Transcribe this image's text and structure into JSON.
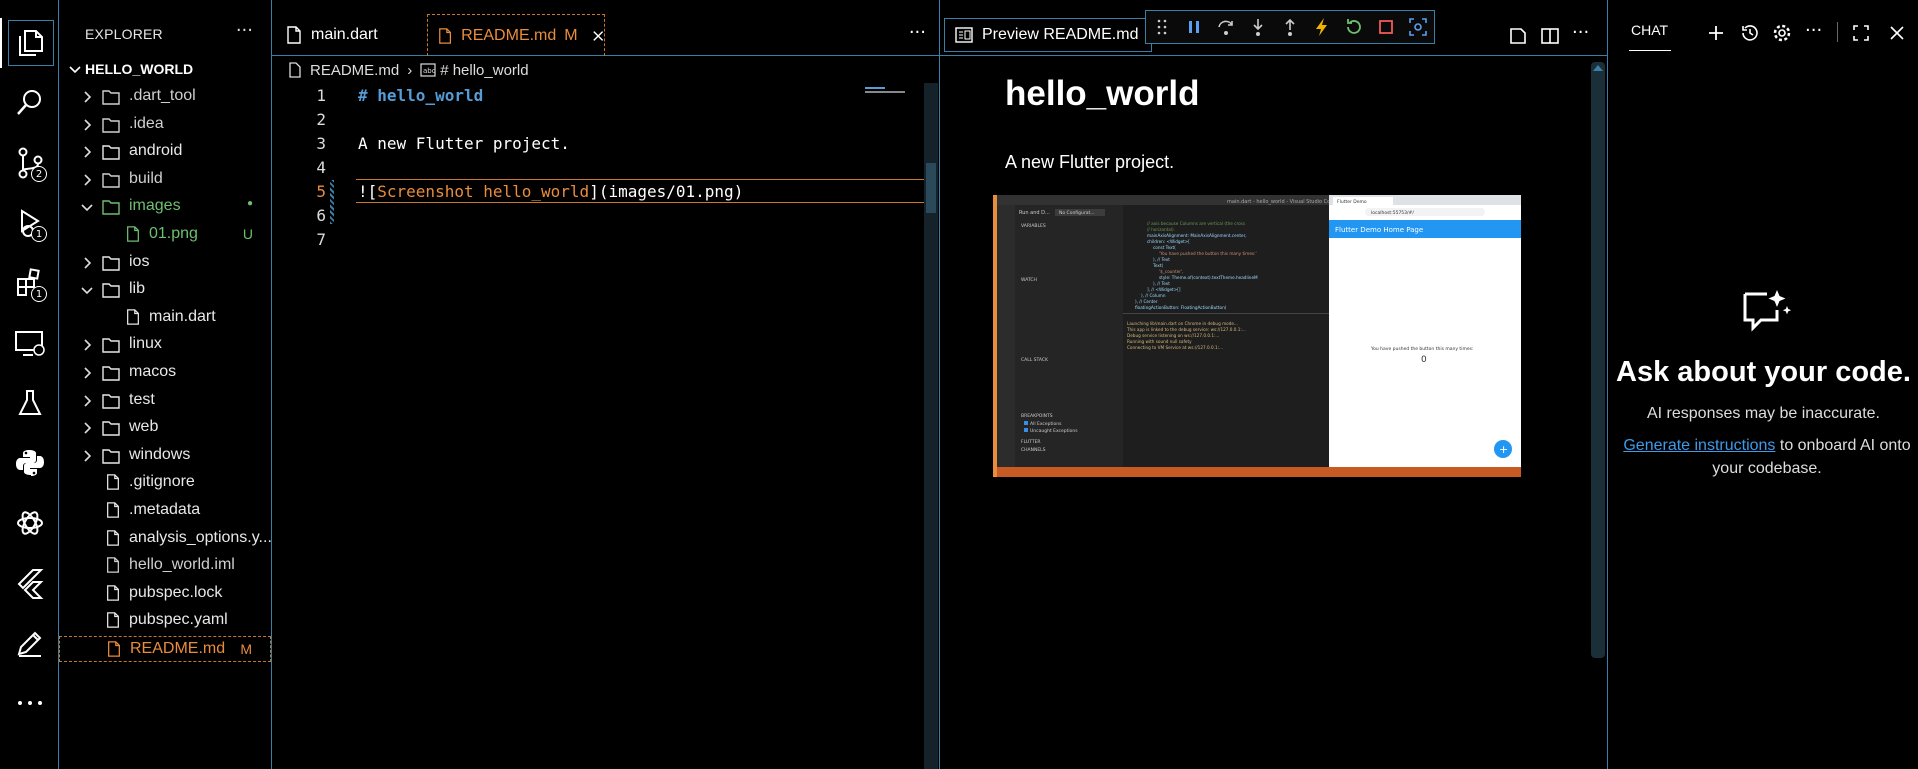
{
  "explorer": {
    "title": "EXPLORER",
    "root": "HELLO_WORLD",
    "items": [
      {
        "label": ".dart_tool",
        "type": "folder",
        "open": false,
        "depth": 1,
        "color": "#cfcfcf",
        "decoration": ""
      },
      {
        "label": ".idea",
        "type": "folder",
        "open": false,
        "depth": 1,
        "color": "#cfcfcf",
        "decoration": ""
      },
      {
        "label": "android",
        "type": "folder",
        "open": false,
        "depth": 1,
        "color": "#e8e8e8",
        "decoration": ""
      },
      {
        "label": "build",
        "type": "folder",
        "open": false,
        "depth": 1,
        "color": "#cfcfcf",
        "decoration": ""
      },
      {
        "label": "images",
        "type": "folder",
        "open": true,
        "depth": 1,
        "color": "#6cc070",
        "decoration": "●"
      },
      {
        "label": "01.png",
        "type": "file",
        "open": false,
        "depth": 2,
        "color": "#6cc070",
        "decoration": "U"
      },
      {
        "label": "ios",
        "type": "folder",
        "open": false,
        "depth": 1,
        "color": "#e8e8e8",
        "decoration": ""
      },
      {
        "label": "lib",
        "type": "folder",
        "open": true,
        "depth": 1,
        "color": "#e8e8e8",
        "decoration": ""
      },
      {
        "label": "main.dart",
        "type": "file",
        "open": false,
        "depth": 2,
        "color": "#e8e8e8",
        "decoration": ""
      },
      {
        "label": "linux",
        "type": "folder",
        "open": false,
        "depth": 1,
        "color": "#e8e8e8",
        "decoration": ""
      },
      {
        "label": "macos",
        "type": "folder",
        "open": false,
        "depth": 1,
        "color": "#e8e8e8",
        "decoration": ""
      },
      {
        "label": "test",
        "type": "folder",
        "open": false,
        "depth": 1,
        "color": "#e8e8e8",
        "decoration": ""
      },
      {
        "label": "web",
        "type": "folder",
        "open": false,
        "depth": 1,
        "color": "#e8e8e8",
        "decoration": ""
      },
      {
        "label": "windows",
        "type": "folder",
        "open": false,
        "depth": 1,
        "color": "#e8e8e8",
        "decoration": ""
      },
      {
        "label": ".gitignore",
        "type": "file",
        "open": false,
        "depth": 1,
        "color": "#e8e8e8",
        "decoration": ""
      },
      {
        "label": ".metadata",
        "type": "file",
        "open": false,
        "depth": 1,
        "color": "#e8e8e8",
        "decoration": ""
      },
      {
        "label": "analysis_options.y...",
        "type": "file",
        "open": false,
        "depth": 1,
        "color": "#e8e8e8",
        "decoration": ""
      },
      {
        "label": "hello_world.iml",
        "type": "file",
        "open": false,
        "depth": 1,
        "color": "#cfcfcf",
        "decoration": ""
      },
      {
        "label": "pubspec.lock",
        "type": "file",
        "open": false,
        "depth": 1,
        "color": "#e8e8e8",
        "decoration": ""
      },
      {
        "label": "pubspec.yaml",
        "type": "file",
        "open": false,
        "depth": 1,
        "color": "#e8e8e8",
        "decoration": ""
      },
      {
        "label": "README.md",
        "type": "file",
        "open": false,
        "depth": 1,
        "color": "#e98c3c",
        "decoration": "M",
        "selected": true
      }
    ]
  },
  "activity_badges": {
    "scm": "2",
    "debug": "1",
    "extensions": "1"
  },
  "editor": {
    "tabs": [
      {
        "label": "main.dart",
        "modified": ""
      },
      {
        "label": "README.md",
        "modified": "M"
      }
    ],
    "breadcrumb_file": "README.md",
    "breadcrumb_symbol": "# hello_world",
    "lines": [
      {
        "n": "1",
        "text": "# hello_world"
      },
      {
        "n": "2",
        "text": ""
      },
      {
        "n": "3",
        "text": "A new Flutter project."
      },
      {
        "n": "4",
        "text": ""
      },
      {
        "n": "5",
        "alt": "Screenshot hello_world",
        "path": "(images/01.png)"
      },
      {
        "n": "6",
        "text": ""
      },
      {
        "n": "7",
        "text": ""
      }
    ]
  },
  "preview": {
    "tab_label": "Preview README.md",
    "heading": "hello_world",
    "paragraph": "A new Flutter project.",
    "image": {
      "window_title": "main.dart - hello_world - Visual Studio Code",
      "run_label": "Run and D...",
      "config": "No Configurat...",
      "sections": [
        "VARIABLES",
        "WATCH",
        "CALL STACK",
        "BREAKPOINTS",
        "FLUTTER",
        "CHANNELS"
      ],
      "breakpoints": [
        "All Exceptions",
        "Uncaught Exceptions"
      ],
      "browser_tab": "Flutter Demo",
      "browser_url": "localhost:55753/#/",
      "app_title": "Flutter Demo Home Page",
      "counter_text": "You have pushed the button this many times:",
      "counter_value": "0",
      "fab_label": "+"
    }
  },
  "chat": {
    "tab": "CHAT",
    "title": "Ask about your code.",
    "subtitle": "AI responses may be inaccurate.",
    "link": "Generate instructions",
    "after_link": " to onboard AI onto your codebase."
  },
  "colors": {
    "accent_border": "#3a7fa5",
    "modified": "#e98c3c",
    "untracked": "#6cc070",
    "link": "#3d9be9"
  }
}
